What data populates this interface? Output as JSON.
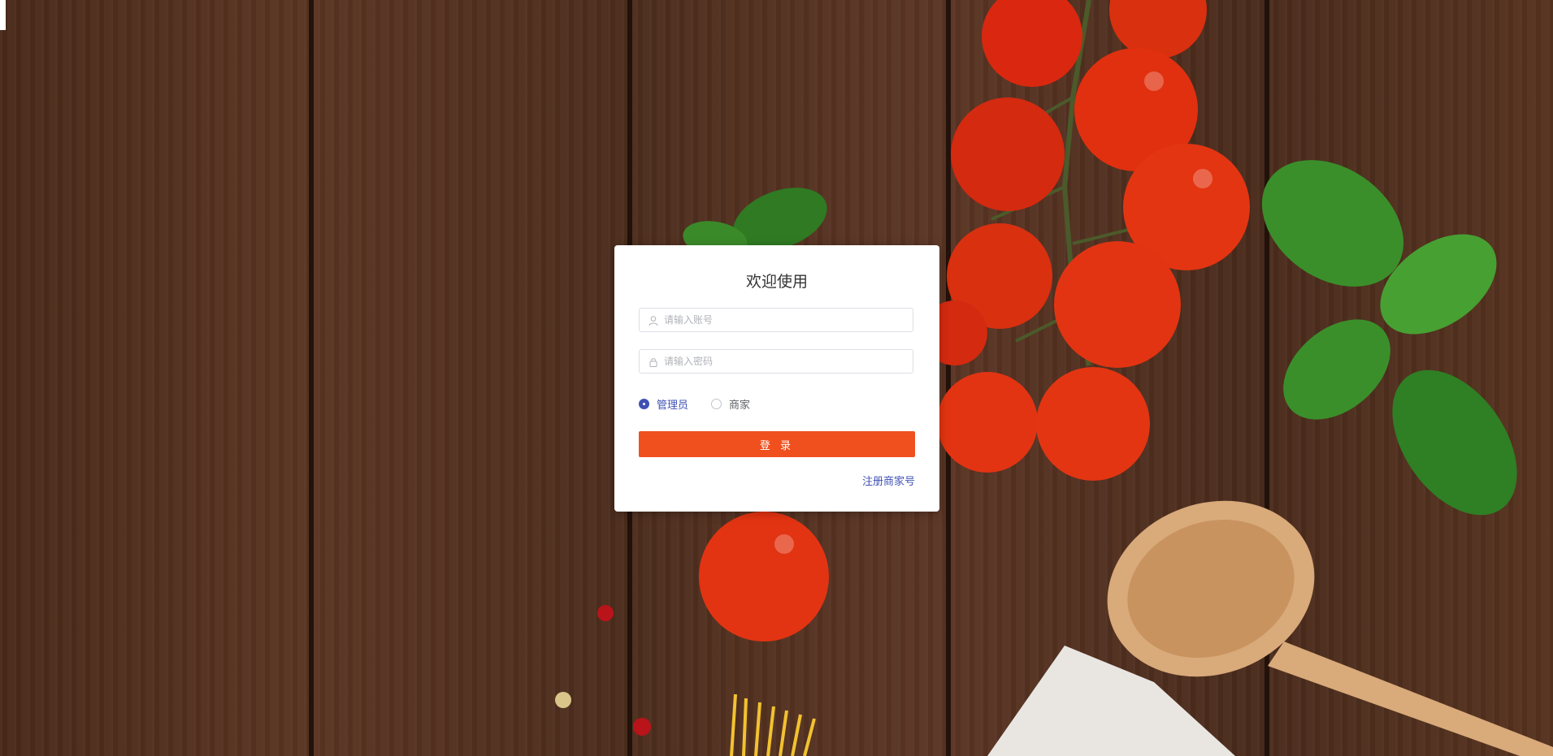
{
  "login": {
    "title": "欢迎使用",
    "username_placeholder": "请输入账号",
    "password_placeholder": "请输入密码",
    "roles": [
      {
        "label": "管理员",
        "selected": true
      },
      {
        "label": "商家",
        "selected": false
      }
    ],
    "login_button": "登 录",
    "register_link": "注册商家号"
  },
  "colors": {
    "accent": "#f0501e",
    "link": "#3f51b5",
    "card_bg": "#ffffff",
    "background_wood": "#4a2a1a"
  },
  "icons": {
    "username": "user-icon",
    "password": "lock-icon"
  }
}
